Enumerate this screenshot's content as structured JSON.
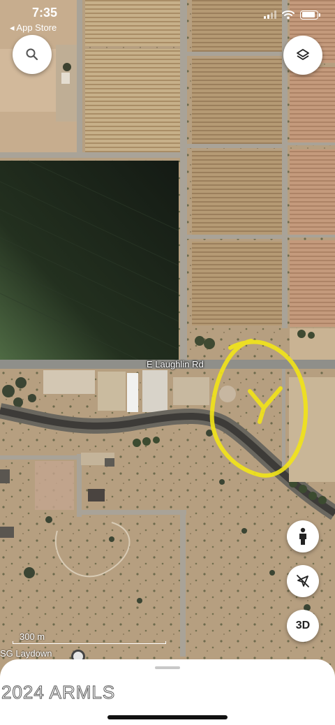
{
  "status_bar": {
    "time": "7:35",
    "back_label": "◂ App Store",
    "battery_percent": 90
  },
  "map": {
    "road_label": "E Laughlin Rd",
    "scale_label": "300 m",
    "place_label": "SG Laydown",
    "annotation_text": "Y",
    "annotation_color": "#f2e418"
  },
  "controls": {
    "search_icon": "search-icon",
    "layers_icon": "layers-icon",
    "street_view_icon": "person-icon",
    "location_icon": "location-off-icon",
    "three_d_label": "3D"
  },
  "sheet": {
    "watermark": "2024 ARMLS"
  }
}
